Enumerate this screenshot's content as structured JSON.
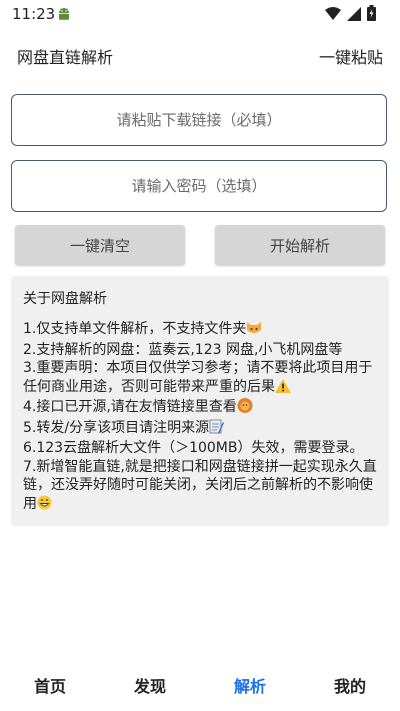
{
  "status": {
    "time": "11:23"
  },
  "app_bar": {
    "title": "网盘直链解析",
    "paste_label": "一键粘贴"
  },
  "form": {
    "url_placeholder": "请粘贴下载链接（必填）",
    "password_placeholder": "请输入密码（选填）",
    "clear_label": "一键清空",
    "start_label": "开始解析"
  },
  "info": {
    "title": "关于网盘解析",
    "lines": [
      "1.仅支持单文件解析，不支持文件夹",
      "2.支持解析的网盘：蓝奏云,123 网盘,小飞机网盘等",
      "3.重要声明：本项目仅供学习参考；请不要将此项目用于任何商业用途，否则可能带来严重的后果",
      "4.接口已开源,请在友情链接里查看",
      "5.转发/分享该项目请注明来源",
      "6.123云盘解析大文件（＞100MB）失效，需要登录。",
      "7.新增智能直链,就是把接口和网盘链接拼一起实现永久直链，还没弄好随时可能关闭，关闭后之前解析的不影响使用"
    ]
  },
  "nav": {
    "home": "首页",
    "discover": "发现",
    "parse": "解析",
    "mine": "我的"
  },
  "colors": {
    "accent": "#1a73e8",
    "card_bg": "#f0f0f0",
    "button_bg": "#d6d6d6"
  }
}
